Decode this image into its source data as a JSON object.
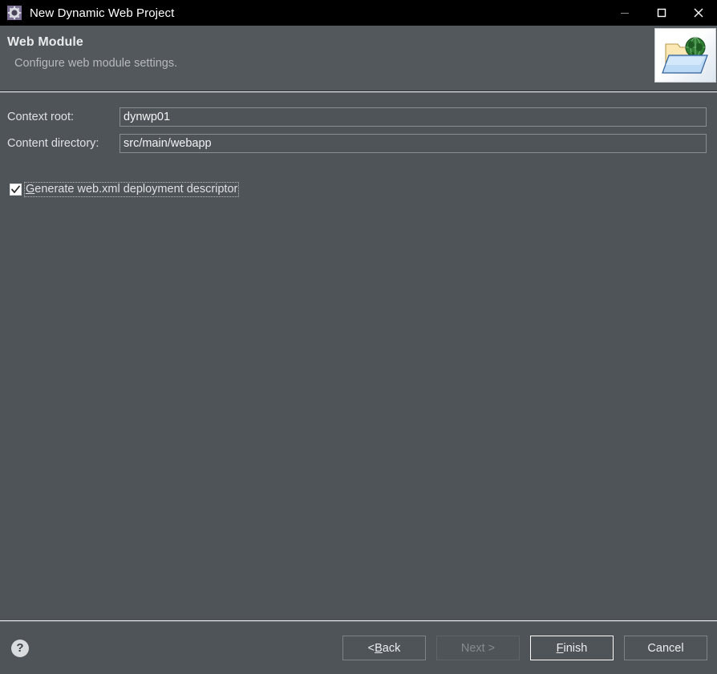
{
  "window": {
    "title": "New Dynamic Web Project",
    "icon": "gear-icon",
    "controls": {
      "minimize": "minimize-icon",
      "maximize": "maximize-icon",
      "close": "close-icon"
    }
  },
  "header": {
    "title": "Web Module",
    "description": "Configure web module settings.",
    "image": "web-folder-globe-icon"
  },
  "form": {
    "fields": [
      {
        "label": "Context root:",
        "value": "dynwp01",
        "placeholder": ""
      },
      {
        "label": "Content directory:",
        "value": "src/main/webapp",
        "placeholder": ""
      }
    ],
    "checkbox": {
      "label_mnemonic": "G",
      "label_rest": "enerate web.xml deployment descriptor",
      "checked": "true"
    }
  },
  "footer": {
    "help": "?",
    "buttons": {
      "back": {
        "prefix": "< ",
        "mnemonic": "B",
        "rest": "ack"
      },
      "next": {
        "label": "Next >"
      },
      "finish": {
        "mnemonic": "F",
        "rest": "inish"
      },
      "cancel": {
        "label": "Cancel"
      }
    }
  },
  "colors": {
    "background": "#4f5458",
    "titlebar": "#000000",
    "text": "#dfe1e3",
    "muted_text": "#b6babd",
    "disabled_text": "#868b8f",
    "border": "#7d8386",
    "default_border": "#ffffff",
    "accent_icon": "#7c6f93"
  }
}
